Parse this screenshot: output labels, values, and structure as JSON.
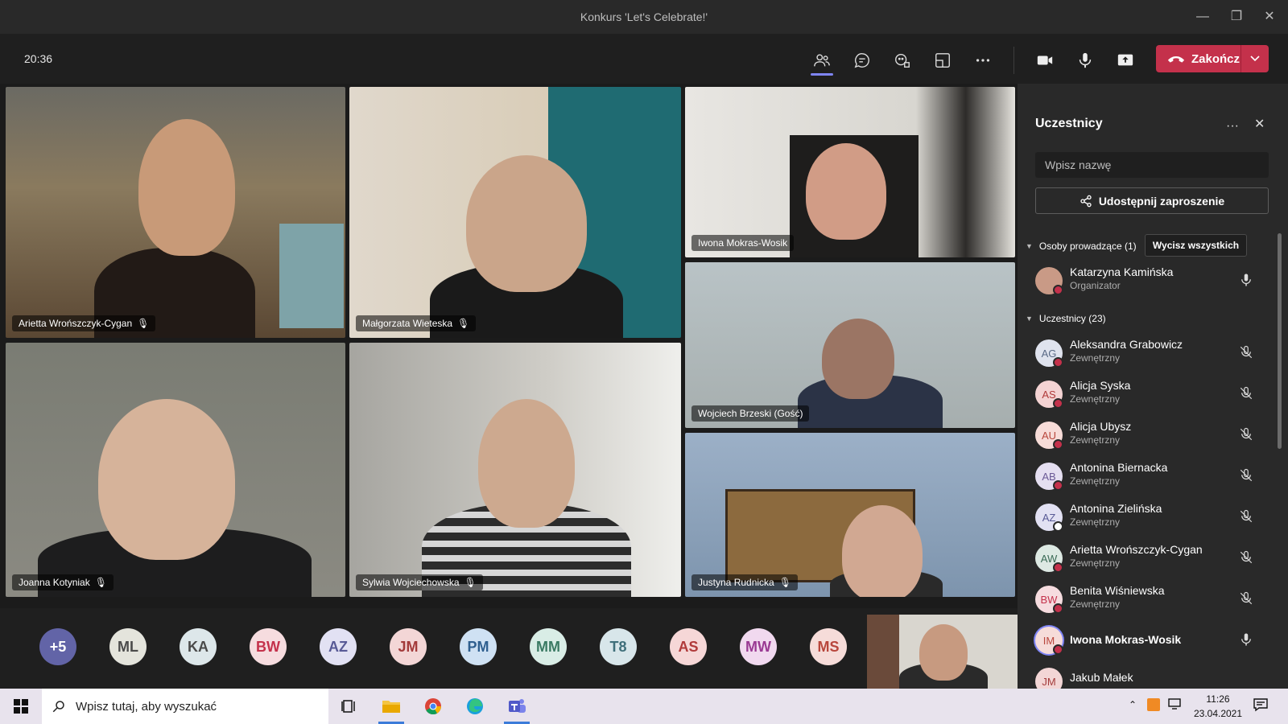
{
  "window": {
    "title": "Konkurs 'Let's Celebrate!'"
  },
  "toolbar": {
    "clock": "20:36",
    "end_label": "Zakończ"
  },
  "tiles": [
    {
      "name": "Arietta Wrońszczyk-Cygan"
    },
    {
      "name": "Małgorzata Wieteska"
    },
    {
      "name": "Iwona Mokras-Wosik"
    },
    {
      "name": "Wojciech Brzeski (Gość)"
    },
    {
      "name": "Joanna Kotyniak"
    },
    {
      "name": "Sylwia Wojciechowska"
    },
    {
      "name": "Justyna Rudnicka"
    }
  ],
  "strip": {
    "avatars": [
      {
        "initials": "+5",
        "color": "#6264a7"
      },
      {
        "initials": "ML",
        "color": "#e4e4dc"
      },
      {
        "initials": "KA",
        "color": "#dde7ea"
      },
      {
        "initials": "BW",
        "color": "#f6dcdf"
      },
      {
        "initials": "AZ",
        "color": "#e2e1f3"
      },
      {
        "initials": "JM",
        "color": "#f3d6d6"
      },
      {
        "initials": "PM",
        "color": "#cfe1f3"
      },
      {
        "initials": "MM",
        "color": "#d9ede6"
      },
      {
        "initials": "T8",
        "color": "#d8e6ea"
      },
      {
        "initials": "AS",
        "color": "#f6d7d7"
      },
      {
        "initials": "MW",
        "color": "#f1d9ef"
      },
      {
        "initials": "MS",
        "color": "#f6dcd9"
      }
    ]
  },
  "panel": {
    "title": "Uczestnicy",
    "search_placeholder": "Wpisz nazwę",
    "invite_label": "Udostępnij zaproszenie",
    "presenters_header": "Osoby prowadzące (1)",
    "mute_all_label": "Wycisz wszystkich",
    "presenters": [
      {
        "name": "Katarzyna Kamińska",
        "role": "Organizator"
      }
    ],
    "attendees_header": "Uczestnicy (23)",
    "attendees": [
      {
        "initials": "AG",
        "name": "Aleksandra Grabowicz",
        "role": "Zewnętrzny"
      },
      {
        "initials": "AS",
        "name": "Alicja Syska",
        "role": "Zewnętrzny"
      },
      {
        "initials": "AU",
        "name": "Alicja Ubysz",
        "role": "Zewnętrzny"
      },
      {
        "initials": "AB",
        "name": "Antonina Biernacka",
        "role": "Zewnętrzny"
      },
      {
        "initials": "AZ",
        "name": "Antonina Zielińska",
        "role": "Zewnętrzny"
      },
      {
        "initials": "AW",
        "name": "Arietta Wrońszczyk-Cygan",
        "role": "Zewnętrzny"
      },
      {
        "initials": "BW",
        "name": "Benita Wiśniewska",
        "role": "Zewnętrzny"
      },
      {
        "initials": "IM",
        "name": "Iwona Mokras-Wosik",
        "role": ""
      },
      {
        "initials": "JM",
        "name": "Jakub Małek",
        "role": ""
      }
    ]
  },
  "taskbar": {
    "search_placeholder": "Wpisz tutaj, aby wyszukać",
    "time": "11:26",
    "date": "23.04.2021"
  }
}
